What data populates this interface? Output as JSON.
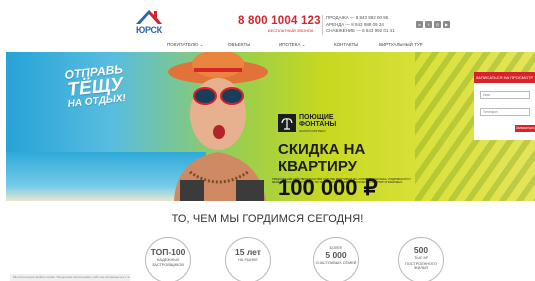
{
  "header": {
    "logo_text": "ЮРСК",
    "phone": "8 800 1004 123",
    "phone_caption": "БЕСПЛАТНЫЙ ЗВОНОК",
    "contacts": [
      "ПРОДАЖА — 8 843 992 00 95",
      "АРЕНДА — 8 843 988 09 34",
      "СНАБЖЕНИЕ — 8 843 992 01 41"
    ],
    "social_icons": [
      "vk-icon",
      "facebook-icon",
      "instagram-icon",
      "youtube-icon"
    ]
  },
  "nav": {
    "items": [
      "ПОКУПАТЕЛЮ",
      "ОБЪЕКТЫ",
      "ИПОТЕКА",
      "КОНТАКТЫ",
      "ВИРТУАЛЬНЫЙ ТУР"
    ]
  },
  "hero": {
    "slogan_line1": "ОТПРАВЬ",
    "slogan_line2": "ТЁЩУ",
    "slogan_line3": "НА ОТДЫХ!",
    "brand_name_line1": "ПОЮЩИЕ",
    "brand_name_line2": "ФОНТАНЫ",
    "brand_sub": "ЖИЛОЙ КОМПЛЕКС",
    "promo_line1": "СКИДКА НА",
    "promo_line2": "КВАРТИРУ",
    "promo_amount": "100 000 ₽",
    "fine_print": "ПРЕДЛОЖЕНИЕ ДЕЙСТВИТЕЛЬНО ПРИ ПОКУПКЕ КВАРТИРЫ В ЖК «ПОЮЩИЕ ФОНТАНЫ». ПОДРОБНОСТИ У МЕНЕДЖЕРОВ ОТДЕЛА ПРОДАЖ ПО ТЕЛЕФОНУ 8 800 1004 123. КОЛИЧЕСТВО КВАРТИР ОГРАНИЧЕНО."
  },
  "form": {
    "title": "ЗАПИСАТЬСЯ НА ПРОСМОТР",
    "name_placeholder": "Имя",
    "phone_placeholder": "Телефон",
    "submit_label": "Записаться"
  },
  "about": {
    "title": "ТО, ЧЕМ МЫ ГОРДИМСЯ СЕГОДНЯ!",
    "stats": [
      {
        "num": "ТОП-100",
        "label": "НАДЕЖНЫХ ЗАСТРОЙЩИКОВ"
      },
      {
        "num": "15 лет",
        "label": "НА РЫНКЕ"
      },
      {
        "pre": "БОЛЕЕ",
        "num": "5 000",
        "label": "СЧАСТЛИВЫХ СЕМЕЙ"
      },
      {
        "num": "500",
        "pre2": "ТЫС М²",
        "label": "ПОСТРОЕННОГО ЖИЛЬЯ"
      }
    ]
  },
  "cookie_text": "Мы используем файлы cookie. Продолжая использовать сайт, вы соглашаетесь с этим."
}
